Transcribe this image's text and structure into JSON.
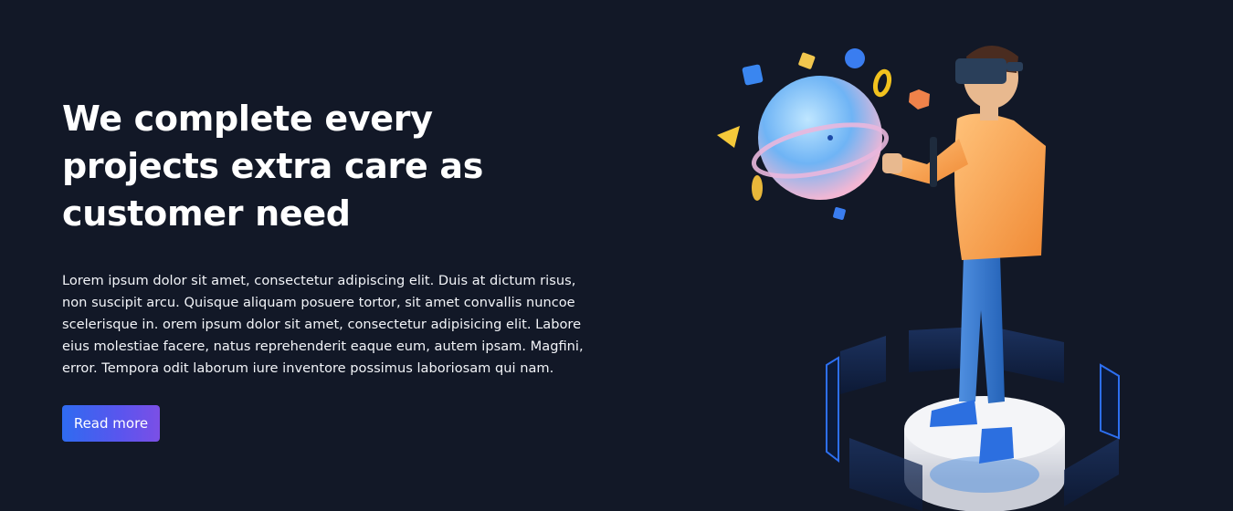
{
  "hero": {
    "headline": "We complete every projects extra care as customer need",
    "body": "Lorem ipsum dolor sit amet, consectetur adipiscing elit. Duis at dictum risus, non suscipit arcu. Quisque aliquam posuere tortor, sit amet convallis nuncoe scelerisque in. orem ipsum dolor sit amet, consectetur adipisicing elit. Labore eius molestiae facere, natus reprehenderit eaque eum, autem ipsam. Magfini, error. Tempora odit laborum iure inventore possimus laboriosam qui nam.",
    "cta_label": "Read more"
  },
  "colors": {
    "background": "#121827",
    "text": "#ffffff",
    "cta_gradient_start": "#2f6bf0",
    "cta_gradient_end": "#7b4fe6"
  },
  "illustration": {
    "icon": "vr-user-illustration"
  }
}
